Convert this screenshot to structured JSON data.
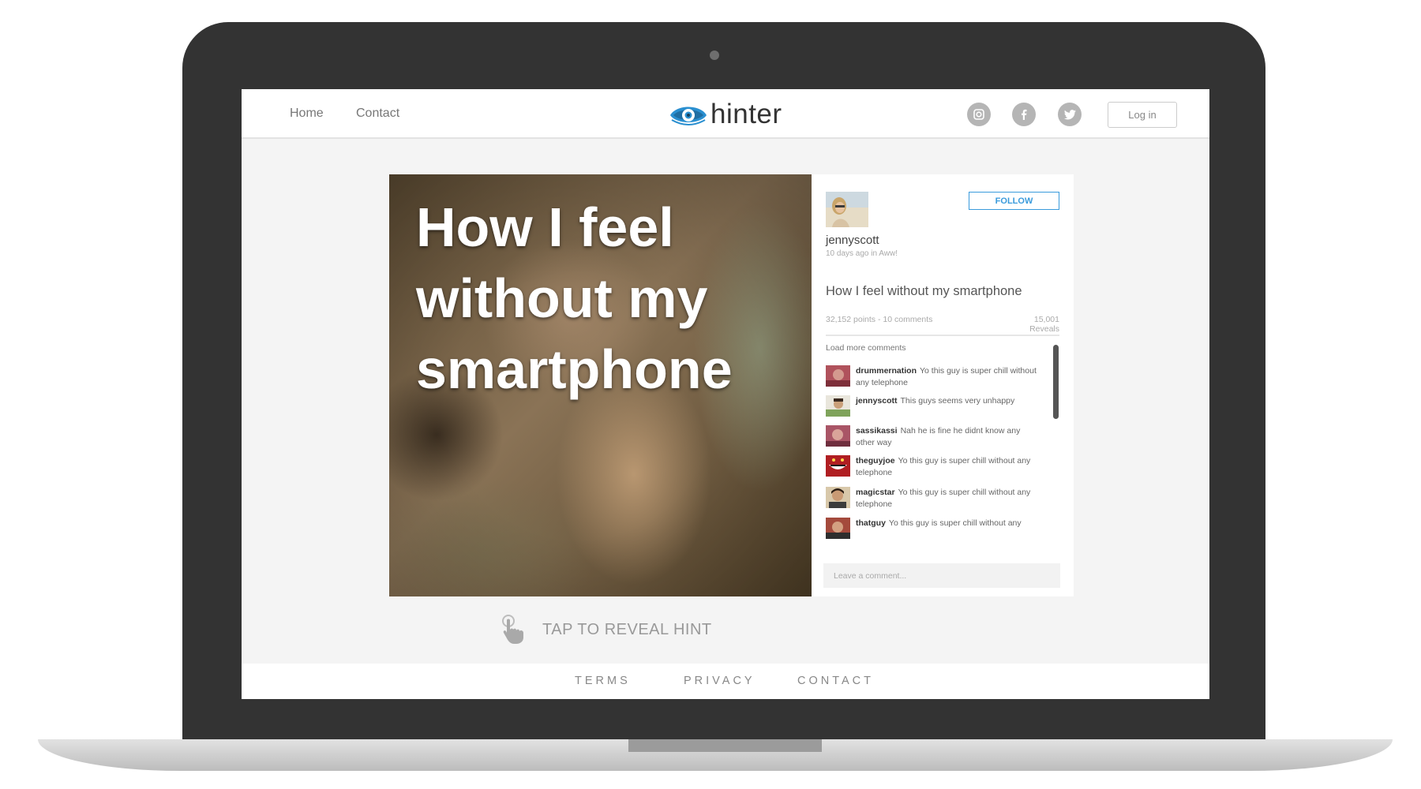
{
  "header": {
    "nav": [
      "Home",
      "Contact"
    ],
    "logo_text": "hinter",
    "social_icons": [
      "instagram-icon",
      "facebook-icon",
      "twitter-icon"
    ],
    "login_label": "Log in"
  },
  "post": {
    "caption": "How I feel without my smartphone",
    "author": "jennyscott",
    "meta": "10 days ago in Aww!",
    "follow_label": "FOLLOW",
    "title": "How I feel without my smartphone",
    "stats": "32,152 points - 10 comments",
    "reveals_count": "15,001",
    "reveals_label": "Reveals",
    "load_more": "Load more comments",
    "comment_placeholder": "Leave a comment...",
    "tap_hint": "TAP TO REVEAL HINT"
  },
  "comments": [
    {
      "user": "drummernation",
      "text": "Yo this guy is super chill without any telephone"
    },
    {
      "user": "jennyscott",
      "text": "This guys seems very unhappy"
    },
    {
      "user": "sassikassi",
      "text": "Nah he is fine he didnt know any other way"
    },
    {
      "user": "theguyjoe",
      "text": "Yo this guy is super chill without any telephone"
    },
    {
      "user": "magicstar",
      "text": "Yo this guy is super chill without any telephone"
    },
    {
      "user": "thatguy",
      "text": "Yo this guy is super chill without any"
    }
  ],
  "footer": {
    "links": [
      "TERMS",
      "PRIVACY",
      "CONTACT"
    ]
  },
  "colors": {
    "accent": "#3a9bdc",
    "logo_blue": "#2a8fd0",
    "laptop_frame": "#333333"
  }
}
